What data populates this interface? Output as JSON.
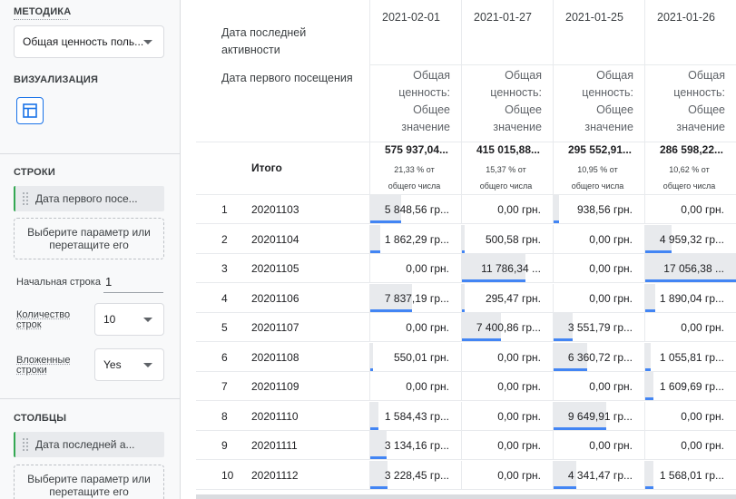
{
  "panel": {
    "method": {
      "title": "МЕТОДИКА",
      "value": "Общая ценность поль..."
    },
    "visualization": {
      "title": "ВИЗУАЛИЗАЦИЯ",
      "icon": "table-icon"
    },
    "rows": {
      "title": "СТРОКИ",
      "chip": "Дата первого посе...",
      "dropzone": "Выберите параметр или перетащите его",
      "start_row_label": "Начальная строка",
      "start_row_value": "1",
      "count_label": "Количество строк",
      "count_value": "10",
      "nested_label": "Вложенные строки",
      "nested_value": "Yes"
    },
    "columns": {
      "title": "СТОЛБЦЫ",
      "chip": "Дата последней а...",
      "dropzone": "Выберите параметр или перетащите его"
    }
  },
  "table": {
    "col_dim_label": "Дата последней активности",
    "row_dim_label": "Дата первого посещения",
    "metric_label": "Общая ценность: Общее значение",
    "total_label": "Итого",
    "columns": [
      {
        "date": "2021-02-01",
        "total": "575 937,04...",
        "share": "21,33 % от общего числа"
      },
      {
        "date": "2021-01-27",
        "total": "415 015,88...",
        "share": "15,37 % от общего числа"
      },
      {
        "date": "2021-01-25",
        "total": "295 552,91...",
        "share": "10,95 % от общего числа"
      },
      {
        "date": "2021-01-26",
        "total": "286 598,22...",
        "share": "10,62 % от общего числа"
      }
    ],
    "rows": [
      {
        "index": "1",
        "date": "20201103",
        "values": [
          "5 848,56 гр...",
          "0,00 грн.",
          "938,56 грн.",
          "0,00 грн."
        ],
        "fill": [
          0.34,
          0,
          0.06,
          0
        ]
      },
      {
        "index": "2",
        "date": "20201104",
        "values": [
          "1 862,29 гр...",
          "500,58 грн.",
          "0,00 грн.",
          "4 959,32 гр..."
        ],
        "fill": [
          0.11,
          0.03,
          0,
          0.29
        ]
      },
      {
        "index": "3",
        "date": "20201105",
        "values": [
          "0,00 грн.",
          "11 786,34 ...",
          "0,00 грн.",
          "17 056,38 ..."
        ],
        "fill": [
          0,
          0.69,
          0,
          1.0
        ]
      },
      {
        "index": "4",
        "date": "20201106",
        "values": [
          "7 837,19 гр...",
          "295,47 грн.",
          "0,00 грн.",
          "1 890,04 гр..."
        ],
        "fill": [
          0.46,
          0.02,
          0,
          0.11
        ]
      },
      {
        "index": "5",
        "date": "20201107",
        "values": [
          "0,00 грн.",
          "7 400,86 гр...",
          "3 551,79 гр...",
          "0,00 грн."
        ],
        "fill": [
          0,
          0.43,
          0.21,
          0
        ]
      },
      {
        "index": "6",
        "date": "20201108",
        "values": [
          "550,01 грн.",
          "0,00 грн.",
          "6 360,72 гр...",
          "1 055,81 гр..."
        ],
        "fill": [
          0.03,
          0,
          0.37,
          0.06
        ]
      },
      {
        "index": "7",
        "date": "20201109",
        "values": [
          "0,00 грн.",
          "0,00 грн.",
          "0,00 грн.",
          "1 609,69 гр..."
        ],
        "fill": [
          0,
          0,
          0,
          0.09
        ]
      },
      {
        "index": "8",
        "date": "20201110",
        "values": [
          "1 584,43 гр...",
          "0,00 грн.",
          "9 649,91 гр...",
          "0,00 грн."
        ],
        "fill": [
          0.09,
          0,
          0.57,
          0
        ]
      },
      {
        "index": "9",
        "date": "20201111",
        "values": [
          "3 134,16 гр...",
          "0,00 грн.",
          "0,00 грн.",
          "0,00 грн."
        ],
        "fill": [
          0.18,
          0,
          0,
          0
        ]
      },
      {
        "index": "10",
        "date": "20201112",
        "values": [
          "3 228,45 гр...",
          "0,00 грн.",
          "4 341,47 гр...",
          "1 568,01 гр..."
        ],
        "fill": [
          0.19,
          0,
          0.25,
          0.09
        ]
      }
    ]
  },
  "colors": {
    "accent": "#1a73e8",
    "bar": "#4285f4",
    "bar_bg": "#e8eaed",
    "chip_border": "#34a853"
  }
}
